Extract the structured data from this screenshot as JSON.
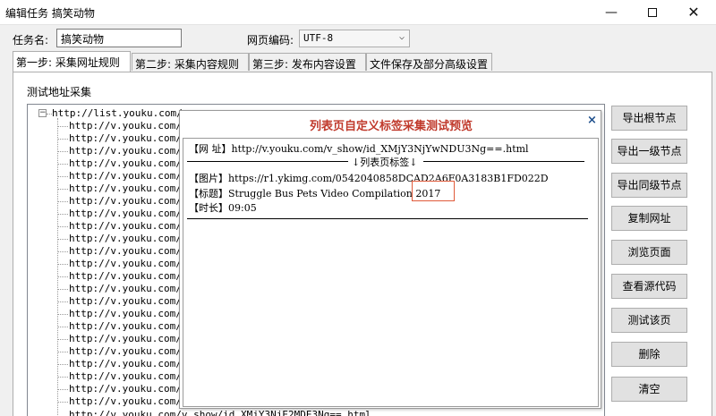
{
  "window": {
    "title": "编辑任务 搞笑动物",
    "minimize": "—",
    "close": "✕"
  },
  "form": {
    "task_name_label": "任务名:",
    "task_name_value": "搞笑动物",
    "encoding_label": "网页编码:",
    "encoding_value": "UTF-8"
  },
  "tabs": [
    {
      "label": "第一步: 采集网址规则"
    },
    {
      "label": "第二步: 采集内容规则"
    },
    {
      "label": "第三步: 发布内容设置"
    },
    {
      "label": "文件保存及部分高级设置"
    }
  ],
  "panel": {
    "group_label": "测试地址采集",
    "root_url": "http://list.youku.com/c",
    "child_url": "http://v.youku.com/v",
    "last_row_text": "http://v.youku.com/v_show/id_XMjY3NjE2MDE3Ng==.html"
  },
  "buttons": {
    "export_root": "导出根节点",
    "export_level1": "导出一级节点",
    "export_sibling": "导出同级节点",
    "copy_url": "复制网址",
    "browse_page": "浏览页面",
    "view_source": "查看源代码",
    "test_page": "测试该页",
    "delete": "删除",
    "clear": "清空"
  },
  "dialog": {
    "title": "列表页自定义标签采集测试预览",
    "close": "×",
    "url_line": "【网  址】http://v.youku.com/v_show/id_XMjY3NjYwNDU3Ng==.html",
    "tag_header": "↓列表页标签↓",
    "image_line": "【图片】https://r1.ykimg.com/0542040858DCAD2A6F0A3183B1FD022D",
    "title_line": "【标题】Struggle Bus Pets Video Compilation 2017",
    "duration_line": "【时长】09:05"
  }
}
